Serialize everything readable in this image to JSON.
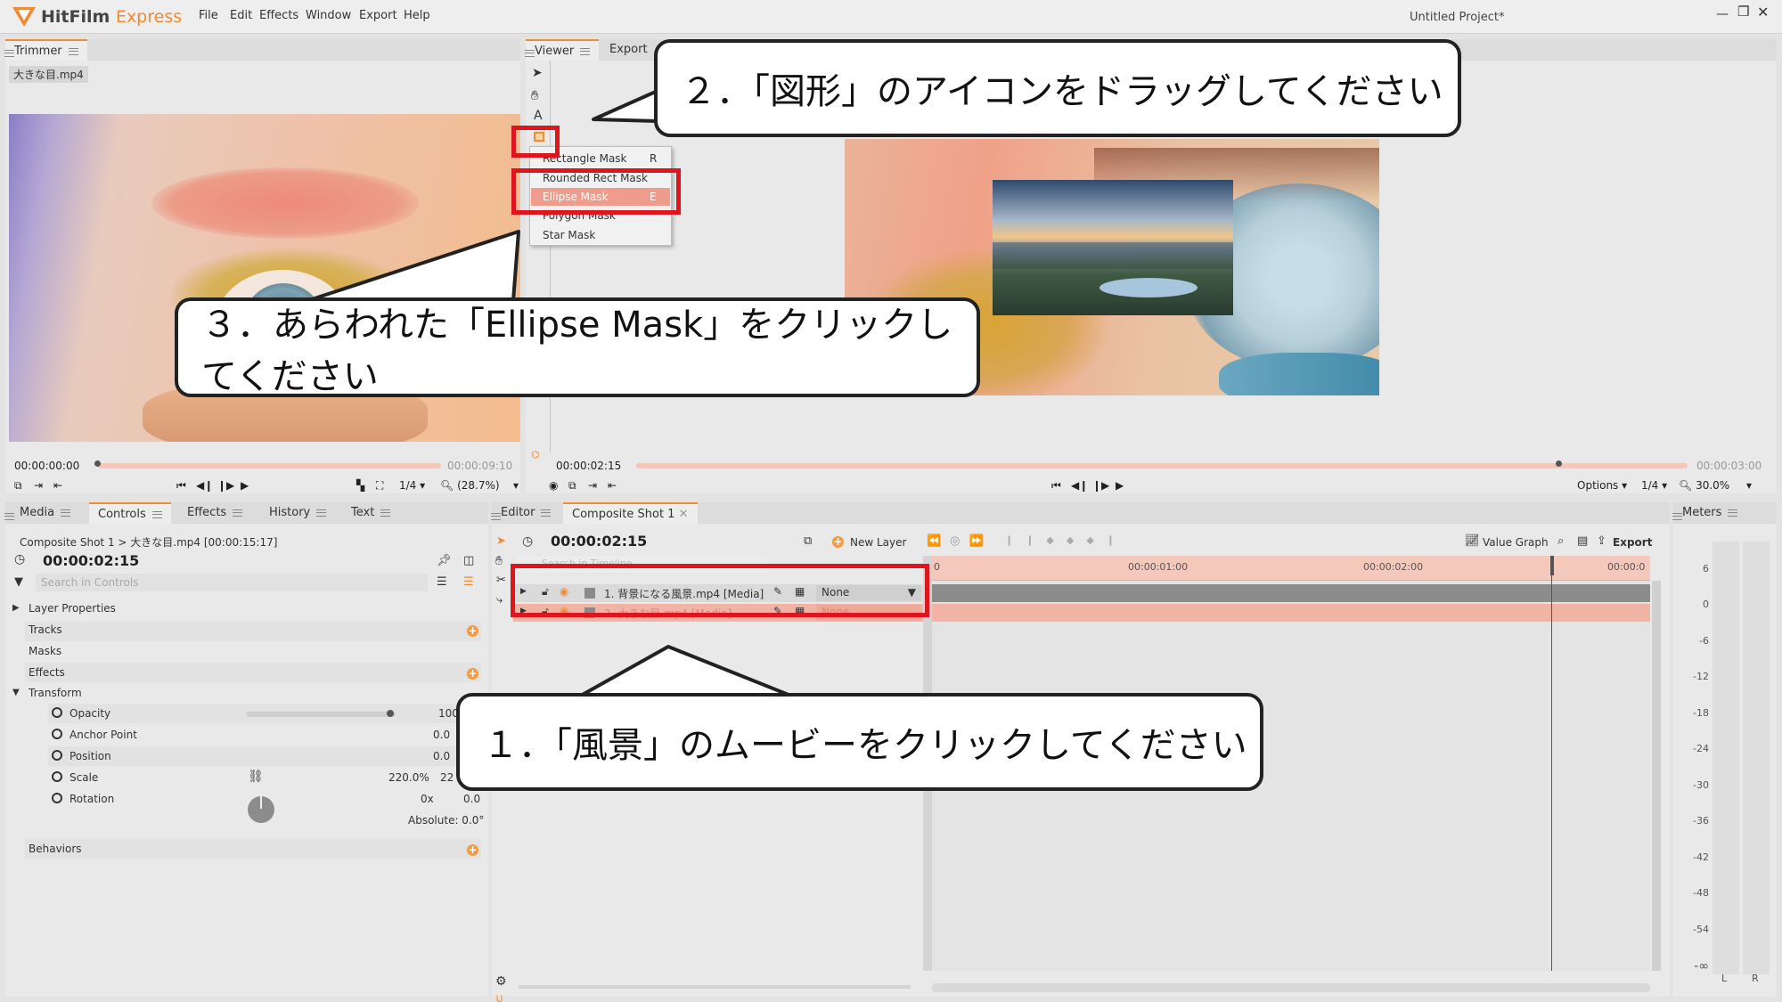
{
  "app": {
    "brand": "HitFilm",
    "brand_suffix": "Express",
    "project_title": "Untitled Project*",
    "menu": [
      "File",
      "Edit",
      "Effects",
      "Window",
      "Export",
      "Help"
    ],
    "accent": "#f08a33"
  },
  "trimmer": {
    "tab": "Trimmer",
    "file": "大きな目.mp4",
    "time_start": "00:00:00:00",
    "time_end": "00:00:09:10",
    "res": "1/4",
    "zoom": "(28.7%)"
  },
  "viewer": {
    "tabs": [
      "Viewer",
      "Export"
    ],
    "time_now": "00:00:02:15",
    "time_end": "00:00:03:00",
    "options": "Options",
    "res": "1/4",
    "zoom": "30.0%",
    "tools_text": "A"
  },
  "context_menu": {
    "items": [
      {
        "label": "Rectangle Mask",
        "key": "R"
      },
      {
        "label": "Rounded Rect Mask",
        "key": ""
      },
      {
        "label": "Ellipse Mask",
        "key": "E"
      },
      {
        "label": "Polygon Mask",
        "key": ""
      },
      {
        "label": "Star Mask",
        "key": ""
      }
    ]
  },
  "left_panel": {
    "tabs": [
      "Media",
      "Controls",
      "Effects",
      "History",
      "Text"
    ],
    "breadcrumb": "Composite Shot 1 > 大きな目.mp4 [00:00:15:17]",
    "time": "00:00:02:15",
    "search_placeholder": "Search in Controls",
    "layer_properties": "Layer Properties",
    "tracks": "Tracks",
    "masks": "Masks",
    "effects": "Effects",
    "transform": "Transform",
    "props": [
      {
        "name": "Opacity",
        "value": "100"
      },
      {
        "name": "Anchor Point",
        "value": "0.0"
      },
      {
        "name": "Position",
        "value": "0.0"
      },
      {
        "name": "Scale",
        "value": "220.0%",
        "value2": "22"
      },
      {
        "name": "Rotation",
        "value": "0.0",
        "value2": "0x"
      }
    ],
    "absolute": "Absolute: 0.0°",
    "behaviors": "Behaviors"
  },
  "editor": {
    "tabs": [
      "Editor",
      "Composite Shot 1"
    ],
    "time": "00:00:02:15",
    "new_layer": "New Layer",
    "value_graph": "Value Graph",
    "export": "Export",
    "search_placeholder": "Search in Timeline",
    "ruler": [
      "0",
      "00:00:01:00",
      "00:00:02:00",
      "00:00:0"
    ],
    "layers": [
      {
        "name": "1. 背景になる風景.mp4 [Media]",
        "blend": "None"
      },
      {
        "name": "2. 大きな目.mp4 [Media]",
        "blend": "None"
      }
    ]
  },
  "meters": {
    "tab": "Meters",
    "scale": [
      "6",
      "0",
      "-6",
      "-12",
      "-18",
      "-24",
      "-30",
      "-36",
      "-42",
      "-48",
      "-54",
      "-∞"
    ],
    "channels": [
      "L",
      "R"
    ]
  },
  "callouts": {
    "step1": "１．「風景」のムービーをクリックしてください",
    "step2": "２．「図形」のアイコンをドラッグしてください",
    "step3": "３．あらわれた「Ellipse Mask」をクリックしてください"
  }
}
